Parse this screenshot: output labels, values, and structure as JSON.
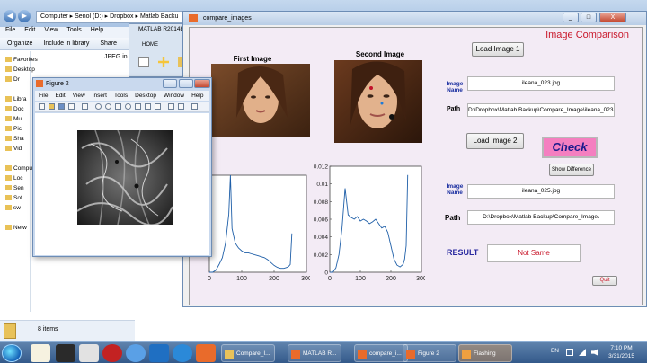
{
  "explorer": {
    "address": [
      "Computer",
      "Senol (D:)",
      "Dropbox",
      "Matlab Backu"
    ],
    "menu": [
      "File",
      "Edit",
      "View",
      "Tools",
      "Help"
    ],
    "commands": [
      "Organize",
      "Include in library",
      "Share"
    ],
    "nav": [
      {
        "label": "Favorites"
      },
      {
        "label": "Desktop"
      },
      {
        "label": "Dr"
      },
      {
        "label": "Libra"
      },
      {
        "label": "Doc"
      },
      {
        "label": "Mu"
      },
      {
        "label": "Pic"
      },
      {
        "label": "Sha"
      },
      {
        "label": "Vid"
      },
      {
        "label": "Compu"
      },
      {
        "label": "Loc"
      },
      {
        "label": "Sen"
      },
      {
        "label": "Sof"
      },
      {
        "label": "sw"
      },
      {
        "label": "Netw"
      }
    ],
    "visible_item": "JPEG in",
    "status_text": "8 items"
  },
  "matlab": {
    "title": "MATLAB R2014b",
    "tab_home": "HOME"
  },
  "gui": {
    "window_title": "compare_images",
    "app_title": "Image Comparison",
    "first_image_caption": "First Image",
    "second_image_caption": "Second Image",
    "load_image_1": "Load Image 1",
    "load_image_2": "Load Image 2",
    "image_name_label": "Image Name",
    "path_label": "Path",
    "image1_name": "ileana_023.jpg",
    "image1_path": "D:\\Dropbox\\Matlab Backup\\Compare_Image\\ileana_023.jpg",
    "image2_name": "ileana_025.jpg",
    "image2_path": "D:\\Dropbox\\Matlab Backup\\Compare_Image\\",
    "check_label": "Check",
    "show_difference_label": "Show Difference",
    "result_label": "RESULT",
    "result_value": "Not Same",
    "quit_label": "Quit",
    "minimize": "_",
    "maximize": "□",
    "close": "X"
  },
  "chart_data": [
    {
      "type": "line",
      "title": "",
      "x": [
        0,
        10,
        20,
        30,
        40,
        50,
        60,
        65,
        70,
        80,
        90,
        100,
        110,
        120,
        130,
        140,
        150,
        160,
        170,
        180,
        190,
        200,
        210,
        220,
        230,
        240,
        245,
        250,
        255
      ],
      "values": [
        0,
        0,
        0.02,
        0.08,
        0.15,
        0.3,
        0.6,
        1.0,
        0.45,
        0.3,
        0.25,
        0.22,
        0.2,
        0.2,
        0.19,
        0.18,
        0.17,
        0.16,
        0.15,
        0.13,
        0.1,
        0.07,
        0.05,
        0.04,
        0.04,
        0.05,
        0.06,
        0.08,
        0.4
      ],
      "xlim": [
        0,
        300
      ],
      "ylim": [
        0,
        1
      ],
      "xticks": [
        0,
        100,
        200,
        300
      ],
      "yticks": [],
      "grid": false
    },
    {
      "type": "line",
      "title": "",
      "x": [
        0,
        10,
        20,
        30,
        40,
        50,
        60,
        70,
        80,
        90,
        100,
        110,
        120,
        130,
        140,
        150,
        160,
        170,
        180,
        190,
        200,
        210,
        220,
        230,
        240,
        245,
        250,
        255
      ],
      "values": [
        0,
        0,
        0.0005,
        0.002,
        0.005,
        0.0095,
        0.0065,
        0.0062,
        0.006,
        0.0063,
        0.0058,
        0.006,
        0.0058,
        0.0055,
        0.0057,
        0.006,
        0.0055,
        0.005,
        0.0052,
        0.0045,
        0.003,
        0.0015,
        0.0008,
        0.0006,
        0.0009,
        0.0015,
        0.003,
        0.011
      ],
      "xlim": [
        0,
        300
      ],
      "ylim": [
        0,
        0.012
      ],
      "xticks": [
        0,
        100,
        200,
        300
      ],
      "yticks": [
        0,
        0.002,
        0.004,
        0.006,
        0.008,
        0.01,
        0.012
      ],
      "ytick_labels": [
        "0",
        "0.002",
        "0.004",
        "0.006",
        "0.008",
        "0.01",
        "0.012"
      ],
      "line_color": "#1f5fa8",
      "grid": false
    }
  ],
  "figure2": {
    "title": "Figure 2",
    "menu": [
      "File",
      "Edit",
      "View",
      "Insert",
      "Tools",
      "Desktop",
      "Window",
      "Help"
    ]
  },
  "taskbar": {
    "tasks": [
      {
        "label": "Compare_I...",
        "icon": "folder-icon"
      },
      {
        "label": "MATLAB R...",
        "icon": "matlab-icon"
      },
      {
        "label": "compare_i...",
        "icon": "matlab-fig-icon"
      },
      {
        "label": "Figure 2",
        "icon": "matlab-fig-icon"
      },
      {
        "label": "Flashing",
        "icon": "window-icon"
      }
    ],
    "language": "EN",
    "time": "7:10 PM",
    "date": "3/31/2015"
  },
  "colors": {
    "accent_red": "#c9182b",
    "check_pink": "#f47fc0",
    "label_blue": "#1a2fa0",
    "canvas_bg": "#f3ebf5"
  }
}
